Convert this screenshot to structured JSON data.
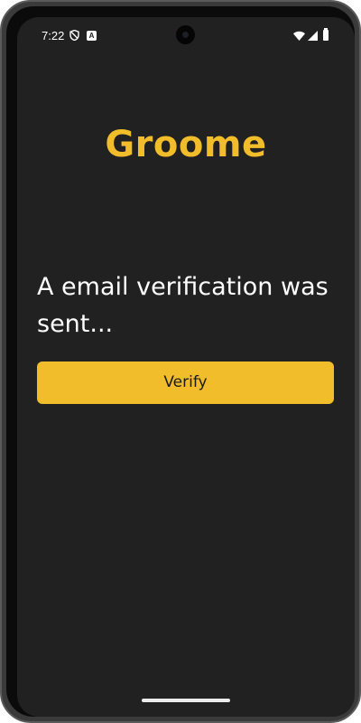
{
  "status_bar": {
    "time": "7:22",
    "icons": [
      "shield-icon",
      "app-notification-icon",
      "wifi-icon",
      "signal-icon",
      "battery-icon"
    ],
    "app_badge": "A"
  },
  "app": {
    "title": "Groome",
    "message": "A email verification was sent...",
    "verify_label": "Verify"
  },
  "colors": {
    "accent": "#f2bd2a",
    "background": "#212121",
    "text": "#ffffff"
  }
}
